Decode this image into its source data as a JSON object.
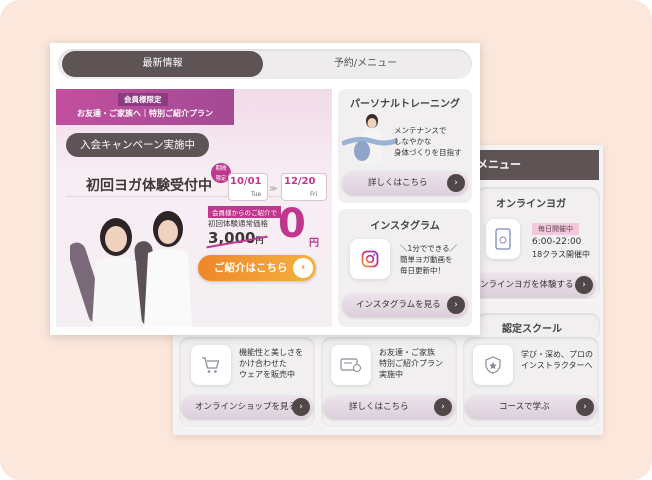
{
  "colors": {
    "accent_magenta": "#c0378f",
    "dark_pill": "#5e5455",
    "cta_orange": "#f0862c",
    "background": "#fbe7db"
  },
  "back_panel": {
    "tab_label": "メニュー",
    "online_yoga": {
      "title": "オンラインヨガ",
      "badge": "毎日開催中",
      "time": "6:00-22:00",
      "classes": "18クラス開催中",
      "button": "ンラインヨガを体験する",
      "icon": "tablet-icon"
    },
    "school": {
      "title": "認定スクール"
    },
    "shop": {
      "lines": [
        "機能性と美しさを",
        "かけ合わせた",
        "ウェアを販売中"
      ],
      "button": "オンラインショップを見る",
      "icon": "cart-icon"
    },
    "referral": {
      "lines": [
        "お友達・ご家族",
        "特別ご紹介プラン",
        "実施中"
      ],
      "button": "詳しくはこちら",
      "icon": "ticket-icon"
    },
    "instructor": {
      "lines": [
        "学び・深め、プロの",
        "インストラクターへ"
      ],
      "button": "コースで学ぶ",
      "icon": "shield-star-icon"
    }
  },
  "front_panel": {
    "tabs": [
      {
        "label": "最新情報",
        "active": true
      },
      {
        "label": "予約/メニュー",
        "active": false
      }
    ],
    "hero": {
      "ribbon_top": "会員様限定",
      "ribbon_bottom": "お友達・ご家族へ｜特別ご紹介プラン",
      "campaign": "入会キャンペーン実施中",
      "headline": "初回ヨガ体験受付中",
      "limit_badge": [
        "期間",
        "限定"
      ],
      "date_start": {
        "month_day": "10/01",
        "weekday": "Tue"
      },
      "date_end": {
        "month_day": "12/20",
        "weekday": "Fri"
      },
      "arrow": "≫",
      "member_label": "会員様からのご紹介で",
      "regular_label": "初回体験通常価格",
      "old_price": "3,000",
      "old_price_unit": "円",
      "new_price": "0",
      "new_price_unit": "円",
      "cta": "ご紹介はこちら"
    },
    "personal": {
      "title": "パーソナルトレーニング",
      "lines": [
        "メンテナンスで",
        "しなやかな",
        "身体づくりを目指す"
      ],
      "button": "詳しくはこちら"
    },
    "instagram": {
      "title": "インスタグラム",
      "lines": [
        "＼1分でできる／",
        "簡単ヨガ動画を",
        "毎日更新中！"
      ],
      "button": "インスタグラムを見る",
      "icon": "instagram-icon"
    },
    "go_glyph": "›"
  }
}
